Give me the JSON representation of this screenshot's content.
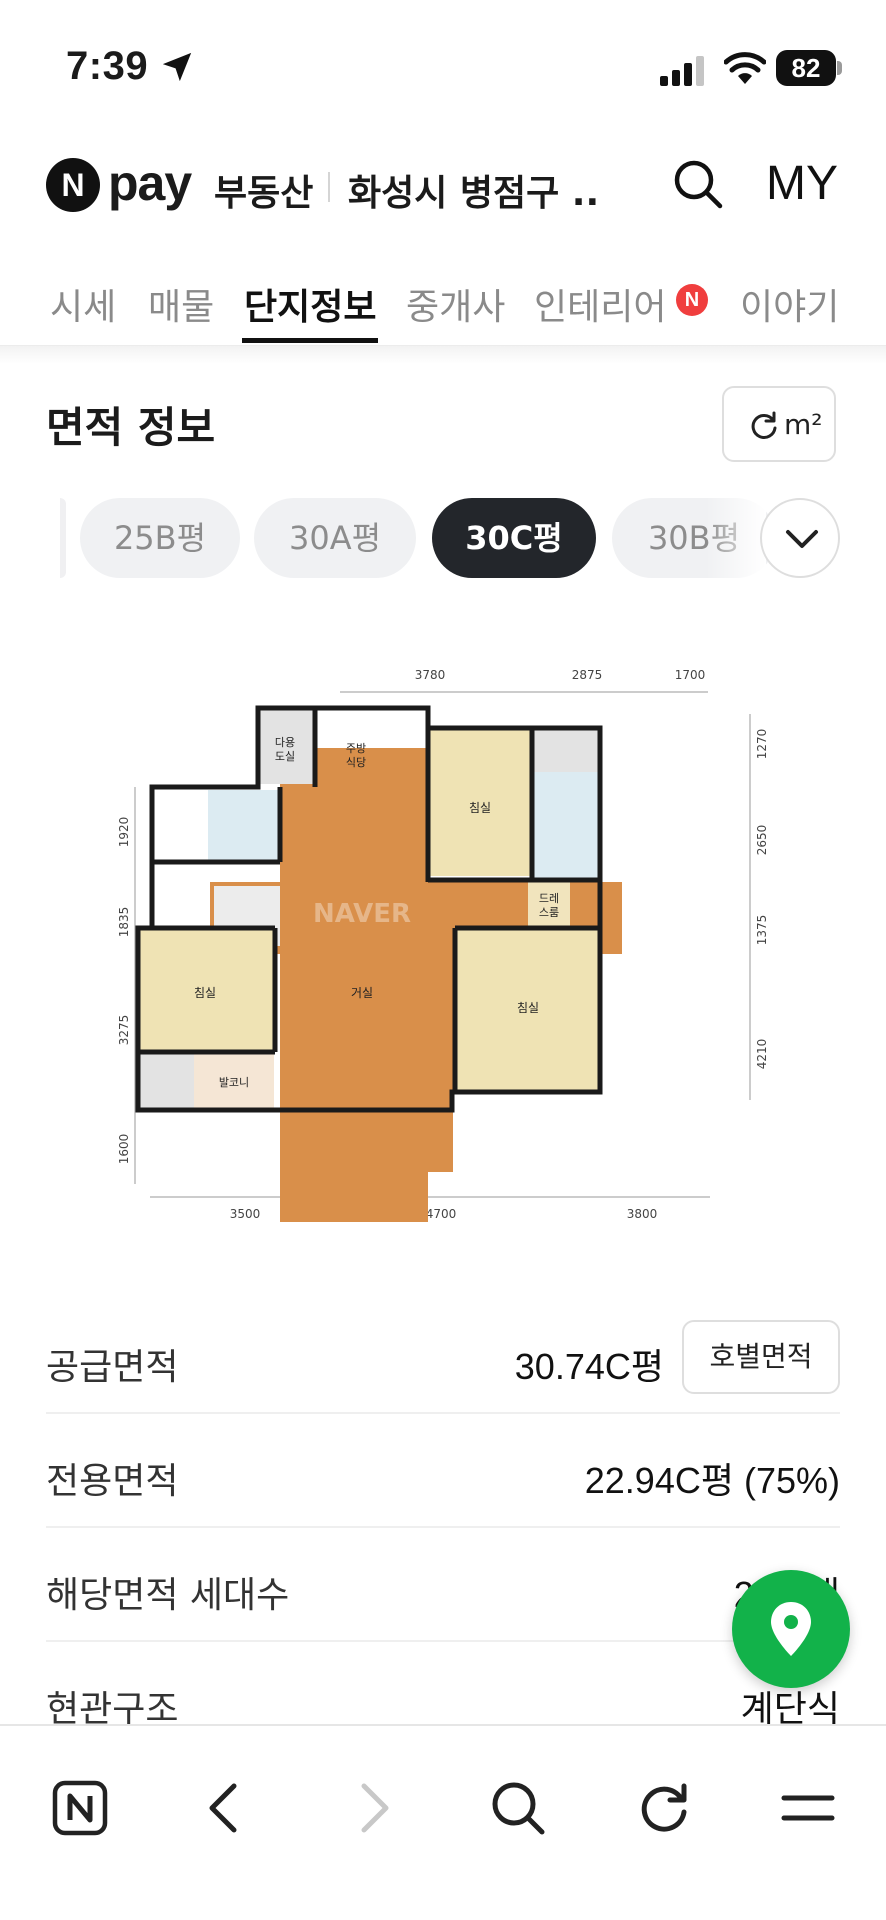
{
  "status_bar": {
    "time": "7:39",
    "battery": "82"
  },
  "header": {
    "logo_mark": "N",
    "logo_pay": "pay",
    "service": "부동산",
    "title": "화성시 병점구 ...",
    "my_label": "MY"
  },
  "tabs": [
    {
      "label": "시세"
    },
    {
      "label": "매물"
    },
    {
      "label": "단지정보"
    },
    {
      "label": "중개사"
    },
    {
      "label": "인테리어"
    },
    {
      "label": "이야기"
    }
  ],
  "tab_badge": "N",
  "section": {
    "title": "면적 정보",
    "unit_label": "m²"
  },
  "chips": [
    {
      "label": "25B평"
    },
    {
      "label": "30A평"
    },
    {
      "label": "30C평"
    },
    {
      "label": "30B평"
    }
  ],
  "floor_plan": {
    "watermark": "NAVER",
    "rooms": {
      "utility": [
        "다용",
        "도실"
      ],
      "kitchen": [
        "주방",
        "식당"
      ],
      "bedroom": "침실",
      "dress": [
        "드레",
        "스룸"
      ],
      "living": "거실",
      "balcony": "발코니"
    },
    "dims_top": [
      "3780",
      "2875",
      "1700"
    ],
    "dims_bottom": [
      "3500",
      "4700",
      "3800"
    ],
    "dims_left": [
      "1920",
      "1835",
      "3275",
      "1600"
    ],
    "dims_right": [
      "1270",
      "2650",
      "1375",
      "4210"
    ]
  },
  "info": {
    "supply_area_label": "공급면적",
    "supply_area_value": "30.74C평",
    "unit_area_button": "호별면적",
    "exclusive_area_label": "전용면적",
    "exclusive_area_value": "22.94C평 (75%)",
    "households_label": "해당면적 세대수",
    "households_value": "27세대",
    "entrance_label": "현관구조",
    "entrance_value": "계단식"
  },
  "colors": {
    "accent_dark": "#23262b",
    "badge_red": "#f03e3e",
    "fab_green": "#12b24a",
    "floor_wood": "#d98f4a",
    "room_beige": "#efe3b4"
  }
}
